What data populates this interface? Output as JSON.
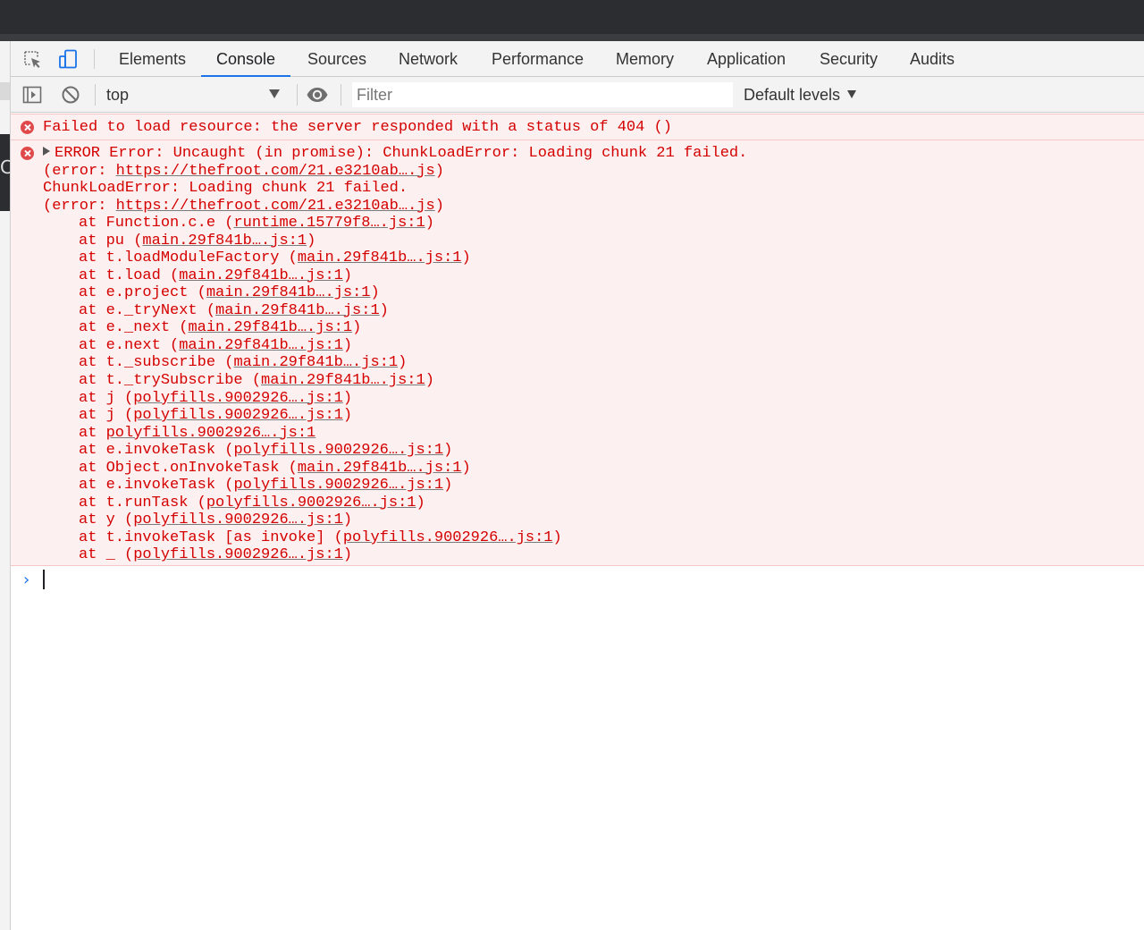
{
  "tabs": [
    {
      "label": "Elements",
      "active": false
    },
    {
      "label": "Console",
      "active": true
    },
    {
      "label": "Sources",
      "active": false
    },
    {
      "label": "Network",
      "active": false
    },
    {
      "label": "Performance",
      "active": false
    },
    {
      "label": "Memory",
      "active": false
    },
    {
      "label": "Application",
      "active": false
    },
    {
      "label": "Security",
      "active": false
    },
    {
      "label": "Audits",
      "active": false
    }
  ],
  "toolbar": {
    "context": "top",
    "filter_placeholder": "Filter",
    "levels": "Default levels"
  },
  "icons": {
    "inspect": "inspect-element-icon",
    "device": "device-toolbar-icon",
    "sidebar": "show-sidebar-icon",
    "clear": "clear-console-icon",
    "eye": "live-expression-icon",
    "error": "error-icon"
  },
  "colors": {
    "error_text": "#d40000",
    "error_bg": "#fdf0f0",
    "accent": "#1a73e8"
  },
  "console": {
    "message1": "Failed to load resource: the server responded with a status of 404 ()",
    "message2": {
      "header": "ERROR Error: Uncaught (in promise): ChunkLoadError: Loading chunk 21 failed.",
      "error_prefix": "(error: ",
      "error_url": "https://thefroot.com/21.e3210ab….js",
      "error_suffix": ")",
      "line3": "ChunkLoadError: Loading chunk 21 failed.",
      "stack": [
        {
          "fn": "Function.c.e ",
          "src": "runtime.15779f8….js:1"
        },
        {
          "fn": "pu ",
          "src": "main.29f841b….js:1"
        },
        {
          "fn": "t.loadModuleFactory ",
          "src": "main.29f841b….js:1"
        },
        {
          "fn": "t.load ",
          "src": "main.29f841b….js:1"
        },
        {
          "fn": "e.project ",
          "src": "main.29f841b….js:1"
        },
        {
          "fn": "e._tryNext ",
          "src": "main.29f841b….js:1"
        },
        {
          "fn": "e._next ",
          "src": "main.29f841b….js:1"
        },
        {
          "fn": "e.next ",
          "src": "main.29f841b….js:1"
        },
        {
          "fn": "t._subscribe ",
          "src": "main.29f841b….js:1"
        },
        {
          "fn": "t._trySubscribe ",
          "src": "main.29f841b….js:1"
        },
        {
          "fn": "j ",
          "src": "polyfills.9002926….js:1"
        },
        {
          "fn": "j ",
          "src": "polyfills.9002926….js:1"
        },
        {
          "fn": "",
          "src": "polyfills.9002926….js:1",
          "bare": true
        },
        {
          "fn": "e.invokeTask ",
          "src": "polyfills.9002926….js:1"
        },
        {
          "fn": "Object.onInvokeTask ",
          "src": "main.29f841b….js:1"
        },
        {
          "fn": "e.invokeTask ",
          "src": "polyfills.9002926….js:1"
        },
        {
          "fn": "t.runTask ",
          "src": "polyfills.9002926….js:1"
        },
        {
          "fn": "y ",
          "src": "polyfills.9002926….js:1"
        },
        {
          "fn": "t.invokeTask [as invoke] ",
          "src": "polyfills.9002926….js:1"
        },
        {
          "fn": "_ ",
          "src": "polyfills.9002926….js:1"
        }
      ]
    },
    "prompt": "›"
  }
}
